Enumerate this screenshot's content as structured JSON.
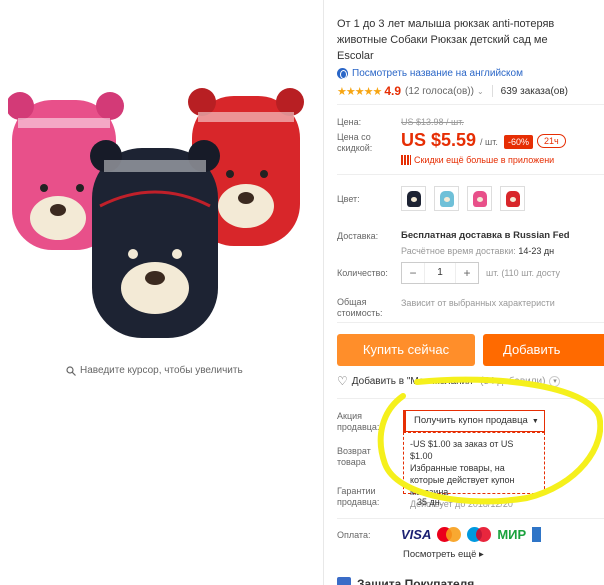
{
  "gallery": {
    "zoom_hint": "Наведите курсор, чтобы увеличить"
  },
  "product": {
    "title_line1": "От 1 до 3 лет малыша рюкзак anti-потеряв",
    "title_line2": "животные Собаки Рюкзак детский сад ме",
    "title_line3": "Escolar",
    "translate_link": "Посмотреть название на английском",
    "rating_stars": "★★★★★",
    "rating_value": "4.9",
    "rating_votes": "(12 голоса(ов))",
    "rating_caret": "⌄",
    "orders": "639 заказа(ов)"
  },
  "labels": {
    "price": "Цена:",
    "sale_price": "Цена со скидкой:",
    "color": "Цвет:",
    "delivery": "Доставка:",
    "quantity": "Количество:",
    "total": "Общая стоимость:",
    "seller_promo": "Акция продавца:",
    "returns": "Возврат товара",
    "guarantee": "Гарантии продавца:",
    "payment": "Оплата:"
  },
  "price": {
    "old": "US $13.98 / шт.",
    "current": "US $5.59",
    "unit": "/ шт.",
    "discount": "-60%",
    "timer": "21ч",
    "app_discount": "Скидки ещё больше в приложени"
  },
  "colors": [
    "#1d2333",
    "#6fc0d8",
    "#e8508a",
    "#d8262a"
  ],
  "delivery": {
    "value": "Бесплатная доставка в Russian Fed",
    "time_label": "Расчётное время доставки:",
    "time_value": "14-23 дн"
  },
  "quantity": {
    "minus": "−",
    "value": "1",
    "plus": "+",
    "note": "шт. (110 шт. досту"
  },
  "total": {
    "value": "Зависит от выбранных характеристи"
  },
  "buttons": {
    "buy_now": "Купить сейчас",
    "add_cart": "Добавить"
  },
  "wishlist": {
    "label": "Добавить в \"Мои желания\"",
    "count": "(54 добавили)"
  },
  "coupon": {
    "button": "Получить купон продавца",
    "line1": "-US $1.00 за заказ от US $1.00",
    "line2": "Избранные товары, на которые действует купон магазина",
    "valid": "Действует до 2018/12/20"
  },
  "returns_days": "35 дн.",
  "payment": {
    "visa": "VISA",
    "mir": "МИР",
    "more": "Посмотреть ещё ▸"
  },
  "protection": "Защита Покупателя"
}
